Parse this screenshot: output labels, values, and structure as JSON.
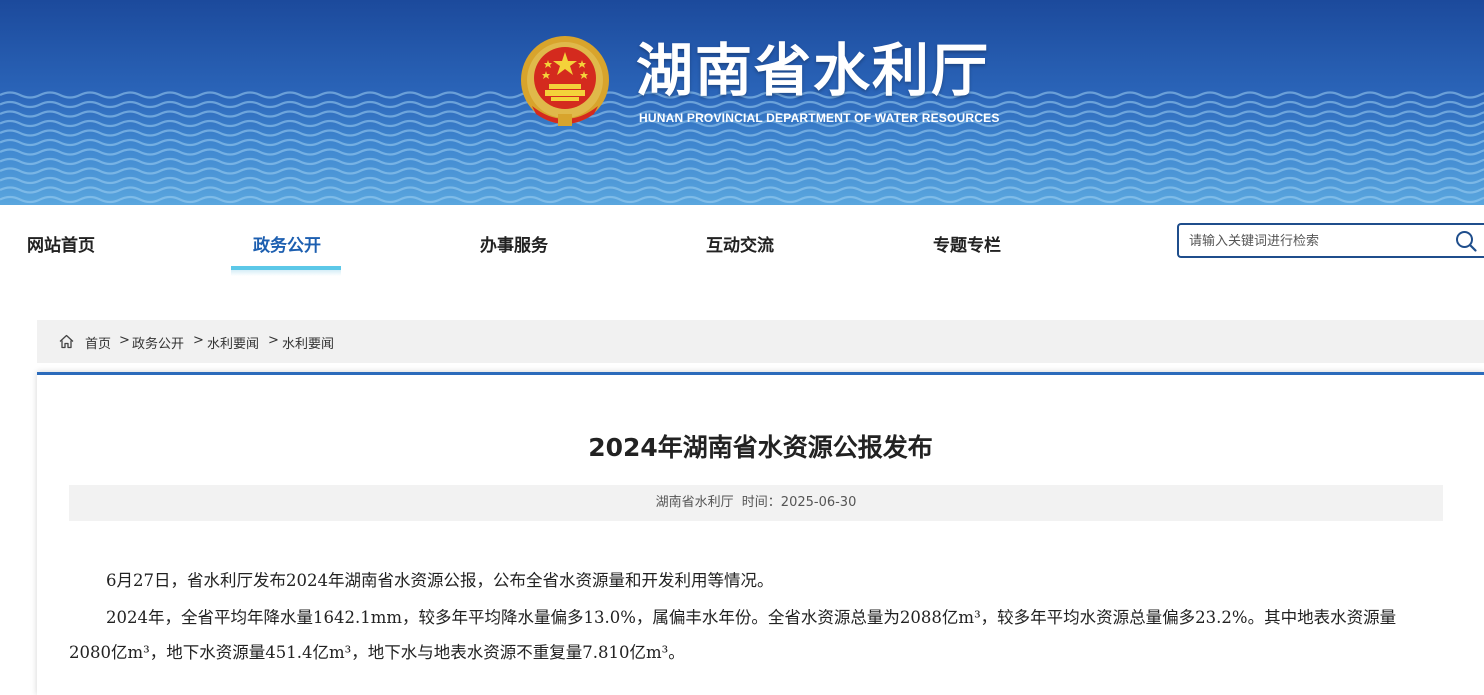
{
  "header": {
    "title": "湖南省水利厅",
    "subtitle": "HUNAN PROVINCIAL DEPARTMENT OF WATER RESOURCES",
    "emblem_icon": "national-emblem-icon"
  },
  "nav": {
    "items": [
      {
        "label": "网站首页",
        "active": false
      },
      {
        "label": "政务公开",
        "active": true
      },
      {
        "label": "办事服务",
        "active": false
      },
      {
        "label": "互动交流",
        "active": false
      },
      {
        "label": "专题专栏",
        "active": false
      }
    ],
    "accent_color": "#1d5fb0"
  },
  "search": {
    "placeholder": "请输入关键词进行检索",
    "value": ""
  },
  "breadcrumb": {
    "items": [
      "首页",
      "政务公开",
      "水利要闻",
      "水利要闻"
    ],
    "separator": ">"
  },
  "article": {
    "title": "2024年湖南省水资源公报发布",
    "source": "湖南省水利厅",
    "time_label": "时间：",
    "time": "2025-06-30",
    "paragraphs": [
      "6月27日，省水利厅发布2024年湖南省水资源公报，公布全省水资源量和开发利用等情况。",
      "2024年，全省平均年降水量1642.1mm，较多年平均降水量偏多13.0%，属偏丰水年份。全省水资源总量为2088亿m³，较多年平均水资源总量偏多23.2%。其中地表水资源量2080亿m³，地下水资源量451.4亿m³，地下水与地表水资源不重复量7.810亿m³。"
    ]
  }
}
